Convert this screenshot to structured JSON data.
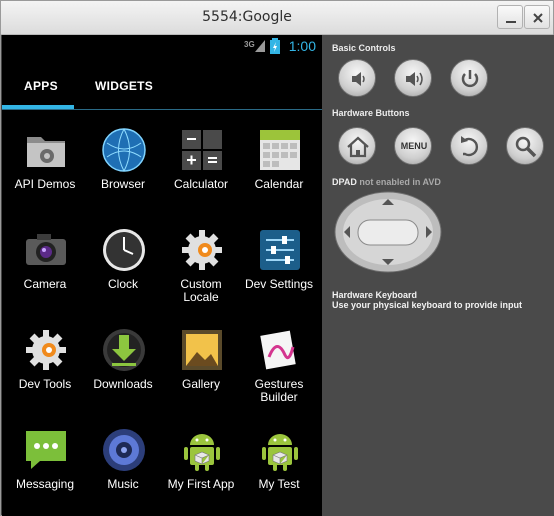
{
  "window": {
    "title": "5554:Google"
  },
  "status_bar": {
    "network": "3G",
    "time": "1:00",
    "accent_color": "#33b5e5"
  },
  "tabs": [
    {
      "label": "APPS"
    },
    {
      "label": "WIDGETS"
    }
  ],
  "apps": [
    {
      "label": "API Demos",
      "icon": "folder-gear-icon"
    },
    {
      "label": "Browser",
      "icon": "globe-icon"
    },
    {
      "label": "Calculator",
      "icon": "calculator-icon"
    },
    {
      "label": "Calendar",
      "icon": "calendar-icon"
    },
    {
      "label": "Camera",
      "icon": "camera-icon"
    },
    {
      "label": "Clock",
      "icon": "clock-icon"
    },
    {
      "label": "Custom Locale",
      "icon": "gear-icon"
    },
    {
      "label": "Dev Settings",
      "icon": "sliders-icon"
    },
    {
      "label": "Dev Tools",
      "icon": "gear-icon"
    },
    {
      "label": "Downloads",
      "icon": "download-icon"
    },
    {
      "label": "Gallery",
      "icon": "picture-icon"
    },
    {
      "label": "Gestures Builder",
      "icon": "gesture-icon"
    },
    {
      "label": "Messaging",
      "icon": "message-icon"
    },
    {
      "label": "Music",
      "icon": "speaker-icon"
    },
    {
      "label": "My First App",
      "icon": "android-icon"
    },
    {
      "label": "My Test",
      "icon": "android-icon"
    }
  ],
  "controls": {
    "basic_label": "Basic Controls",
    "hardware_label": "Hardware Buttons",
    "menu_label": "MENU",
    "dpad_label": "DPAD",
    "dpad_note": "not enabled in AVD",
    "keyboard_label": "Hardware Keyboard",
    "keyboard_note": "Use your physical keyboard to provide input"
  }
}
